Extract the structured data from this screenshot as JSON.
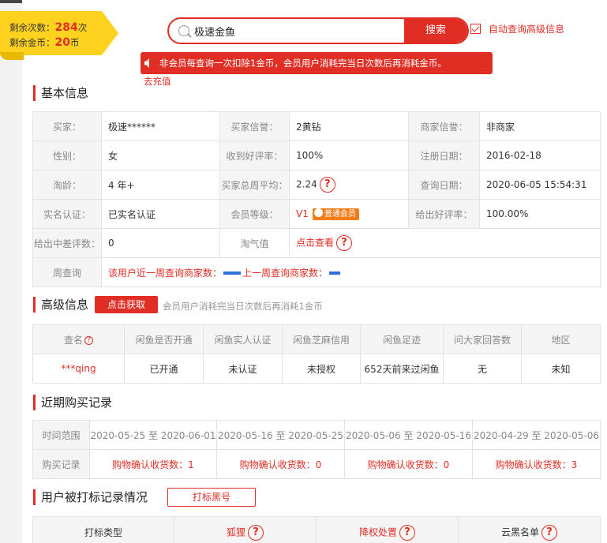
{
  "quota": {
    "times_label": "剩余次数：",
    "times_value": "284",
    "times_unit": "次",
    "coins_label": "剩余金币：",
    "coins_value": "20",
    "coins_unit": "币"
  },
  "search": {
    "value": "极速金鱼",
    "button": "搜索",
    "auto_label": "自动查询高级信息"
  },
  "notice": "非会员每查询一次扣除1金币，会员用户消耗完当日次数后再消耗金币。",
  "recharge": "去充值",
  "basic": {
    "title": "基本信息",
    "rows": [
      [
        "买家：",
        "极速******",
        "买家信誉：",
        "2黄钻",
        "商家信誉：",
        "非商家"
      ],
      [
        "性别：",
        "女",
        "收到好评率：",
        "100%",
        "注册日期：",
        "2016-02-18"
      ],
      [
        "淘龄：",
        "4 年+",
        "买家总周平均：",
        "2.24",
        "查询日期：",
        "2020-06-05 15:54:31"
      ],
      [
        "实名认证：",
        "已实名认证",
        "会员等级：",
        "V1",
        "给出好评率：",
        "100.00%"
      ],
      [
        "给出中差评数：",
        "0",
        "淘气值",
        "点击查看"
      ]
    ],
    "member_badge": "普通会员",
    "week_label": "周查询",
    "week_text": "该用户近一周查询商家数：",
    "week_text2": "上一周查询商家数："
  },
  "advanced": {
    "title": "高级信息",
    "button": "点击获取",
    "note": "会员用户消耗完当日次数后再消耗1金币",
    "headers": [
      "查名",
      "闲鱼是否开通",
      "闲鱼实人认证",
      "闲鱼芝麻信用",
      "闲鱼足迹",
      "问大家回答数",
      "地区"
    ],
    "values": [
      "***qing",
      "已开通",
      "未认证",
      "未授权",
      "652天前来过闲鱼",
      "无",
      "未知"
    ]
  },
  "purchase": {
    "title": "近期购买记录",
    "range_label": "时间范围",
    "record_label": "购买记录",
    "ranges": [
      "2020-05-25 至 2020-06-01",
      "2020-05-16 至 2020-05-25",
      "2020-05-06 至 2020-05-16",
      "2020-04-29 至 2020-05-06"
    ],
    "records": [
      "购物确认收货数：1",
      "购物确认收货数：0",
      "购物确认收货数：0",
      "购物确认收货数：3"
    ]
  },
  "marks": {
    "title": "用户被打标记录情况",
    "button": "打标黑号",
    "headers": [
      "打标类型",
      "狐狸",
      "降权处置",
      "云黑名单"
    ]
  }
}
